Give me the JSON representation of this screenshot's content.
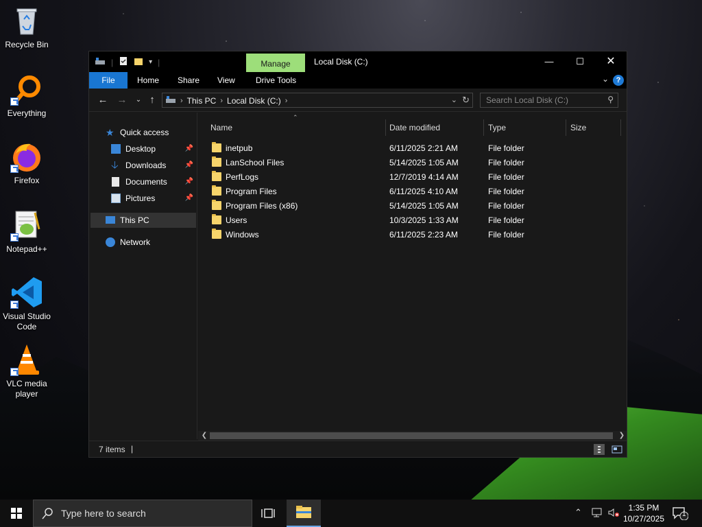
{
  "desktop": {
    "icons": [
      {
        "label": "Recycle Bin"
      },
      {
        "label": "Everything"
      },
      {
        "label": "Firefox"
      },
      {
        "label": "Notepad++"
      },
      {
        "label": "Visual Studio Code"
      },
      {
        "label": "VLC media player"
      }
    ]
  },
  "window": {
    "title": "Local Disk (C:)",
    "context_tab": "Manage",
    "ribbon_tabs": [
      "File",
      "Home",
      "Share",
      "View",
      "Drive Tools"
    ],
    "address": {
      "crumbs": [
        "This PC",
        "Local Disk (C:)"
      ]
    },
    "search": {
      "placeholder": "Search Local Disk (C:)"
    },
    "nav": {
      "quick_access": "Quick access",
      "items": [
        {
          "label": "Desktop"
        },
        {
          "label": "Downloads"
        },
        {
          "label": "Documents"
        },
        {
          "label": "Pictures"
        }
      ],
      "this_pc": "This PC",
      "network": "Network"
    },
    "columns": {
      "name": "Name",
      "date": "Date modified",
      "type": "Type",
      "size": "Size"
    },
    "files": [
      {
        "name": "inetpub",
        "date": "6/11/2025 2:21 AM",
        "type": "File folder"
      },
      {
        "name": "LanSchool Files",
        "date": "5/14/2025 1:05 AM",
        "type": "File folder"
      },
      {
        "name": "PerfLogs",
        "date": "12/7/2019 4:14 AM",
        "type": "File folder"
      },
      {
        "name": "Program Files",
        "date": "6/11/2025 4:10 AM",
        "type": "File folder"
      },
      {
        "name": "Program Files (x86)",
        "date": "5/14/2025 1:05 AM",
        "type": "File folder"
      },
      {
        "name": "Users",
        "date": "10/3/2025 1:33 AM",
        "type": "File folder"
      },
      {
        "name": "Windows",
        "date": "6/11/2025 2:23 AM",
        "type": "File folder"
      }
    ],
    "status": {
      "count": "7 items"
    }
  },
  "taskbar": {
    "search_placeholder": "Type here to search",
    "time": "1:35 PM",
    "date": "10/27/2025",
    "notification_count": "1"
  },
  "colors": {
    "accent": "#1976d2",
    "manage_tab": "#9dde7a",
    "folder": "#f6d46b"
  },
  "icons": [
    "recycle-bin-icon",
    "everything-icon",
    "firefox-icon",
    "notepadpp-icon",
    "vscode-icon",
    "vlc-icon",
    "folder-icon",
    "star-icon",
    "pin-icon",
    "windows-start-icon",
    "search-icon",
    "task-view-icon",
    "file-explorer-icon",
    "network-icon",
    "volume-icon",
    "chevron-up-icon",
    "notification-icon"
  ]
}
